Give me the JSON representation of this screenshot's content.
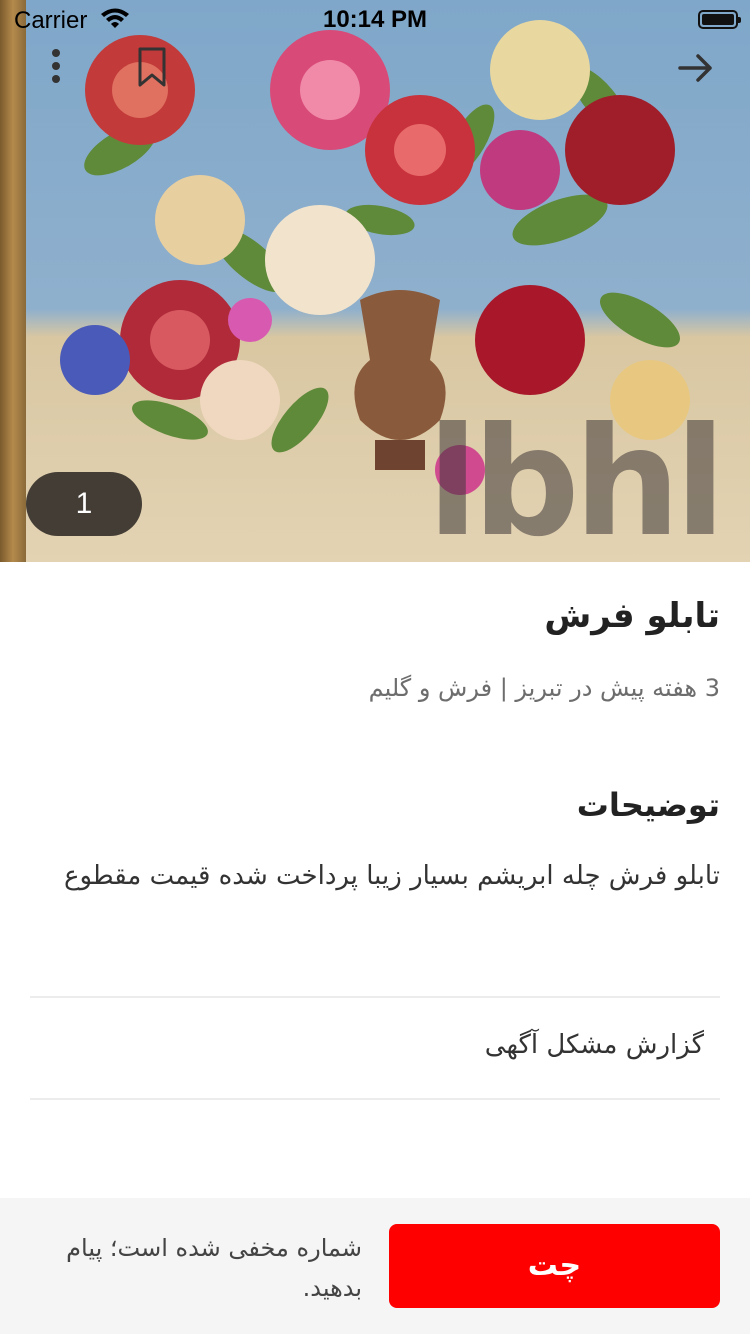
{
  "status_bar": {
    "carrier": "Carrier",
    "time": "10:14 PM"
  },
  "hero": {
    "image_counter": "1",
    "watermark": "lbhl"
  },
  "ad": {
    "title": "تابلو فرش",
    "meta": "3 هفته پیش در تبریز | فرش و گلیم",
    "description_heading": "توضیحات",
    "description": "تابلو فرش چله ابریشم بسیار زیبا پرداخت شده قیمت مقطوع",
    "report_label": "گزارش مشکل آگهی"
  },
  "bottom_bar": {
    "chat_label": "چت",
    "hidden_number_note": "شماره مخفی شده است؛ پیام بدهید."
  },
  "colors": {
    "accent": "#ff0000",
    "bottom_bar_bg": "#f5f5f5"
  }
}
